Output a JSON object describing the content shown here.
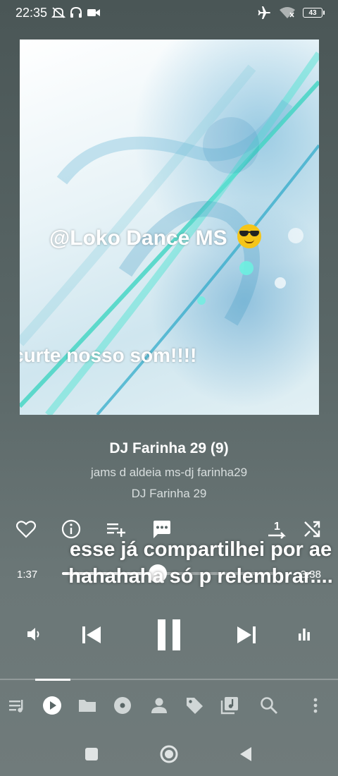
{
  "status_bar": {
    "time": "22:35",
    "battery_level": "43",
    "icons": [
      "mute-icon",
      "headphones-icon",
      "video-camera-icon",
      "airplane-mode-icon",
      "wifi-icon",
      "battery-icon"
    ]
  },
  "album_art": {
    "overlay_text_1": "@Loko Dance MS",
    "overlay_emoji": "sunglasses-emoji",
    "overlay_text_2": "curte nosso som!!!!"
  },
  "track": {
    "title": "DJ Farinha 29 (9)",
    "artist": "jams d aldeia ms-dj farinha29",
    "album": "DJ Farinha 29"
  },
  "action_row": {
    "icons": [
      "heart-icon",
      "info-icon",
      "add-to-playlist-icon",
      "comment-icon",
      "repeat-one-icon",
      "shuffle-icon"
    ]
  },
  "comment_overlay": {
    "text": "esse já compartilhei por ae hahahaha só p relembrar...."
  },
  "playback": {
    "current_time": "1:37",
    "total_time": "3:38",
    "progress_fraction": 0.445,
    "state": "playing"
  },
  "transport": {
    "icons": [
      "volume-icon",
      "skip-previous-icon",
      "pause-icon",
      "skip-next-icon",
      "equalizer-icon"
    ]
  },
  "bottom_nav": {
    "active_index": 1,
    "items": [
      "queue-icon",
      "now-playing-icon",
      "folder-icon",
      "album-icon",
      "artist-icon",
      "tag-icon",
      "playlist-icon",
      "search-icon",
      "more-vertical-icon"
    ]
  },
  "system_nav": {
    "icons": [
      "recents-icon",
      "home-icon",
      "back-icon"
    ]
  },
  "colors": {
    "accent": "#ffffff",
    "background_top": "#4a5656",
    "background_bottom": "#707b7b",
    "emoji_yellow": "#f5c518"
  }
}
